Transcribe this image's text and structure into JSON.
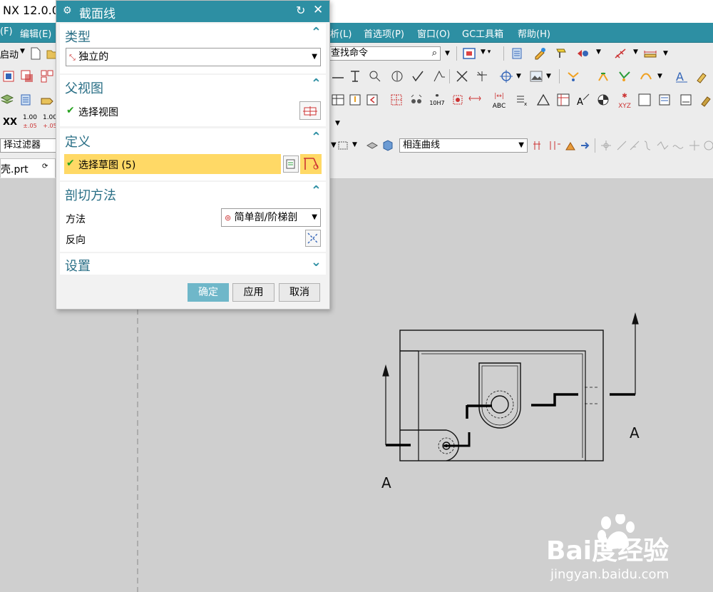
{
  "app": {
    "title": "NX 12.0.0"
  },
  "menubar": {
    "items": [
      "(F)",
      "编辑(E)",
      "析(L)",
      "首选项(P)",
      "窗口(O)",
      "GC工具箱",
      "帮助(H)"
    ]
  },
  "toolbar1": {
    "start_label": "启动",
    "search_placeholder": "查找命令"
  },
  "toolbar2": {},
  "toolbar3": {
    "items": [
      "10H7",
      "ABC",
      "XYZ"
    ]
  },
  "toolbar4": {
    "xx_label": "XX",
    "tol1_top": "1.00",
    "tol1_bot": "±.05",
    "tol2_top": "1.00",
    "tol2_bot": "+.05"
  },
  "filterbar": {
    "filter_label": "择过滤器",
    "curve_rule": "相连曲线"
  },
  "tab": {
    "label": "壳.prt"
  },
  "dialog": {
    "title": "截面线",
    "type_group": {
      "header": "类型",
      "value": "独立的"
    },
    "parent_view_group": {
      "header": "父视图",
      "select_label": "选择视图"
    },
    "definition_group": {
      "header": "定义",
      "select_label": "选择草图 (5)"
    },
    "cut_method_group": {
      "header": "剖切方法",
      "method_label": "方法",
      "method_value": "简单剖/阶梯剖",
      "reverse_label": "反向"
    },
    "settings_group": {
      "header": "设置"
    },
    "buttons": {
      "ok": "确定",
      "apply": "应用",
      "cancel": "取消"
    }
  },
  "drawing": {
    "label_left": "A",
    "label_right": "A"
  },
  "watermark": {
    "logo": "Bai度经验",
    "url": "jingyan.baidu.com"
  },
  "colors": {
    "accent": "#2d8fa3",
    "selected_row": "#ffd966",
    "check": "#26a21f"
  }
}
